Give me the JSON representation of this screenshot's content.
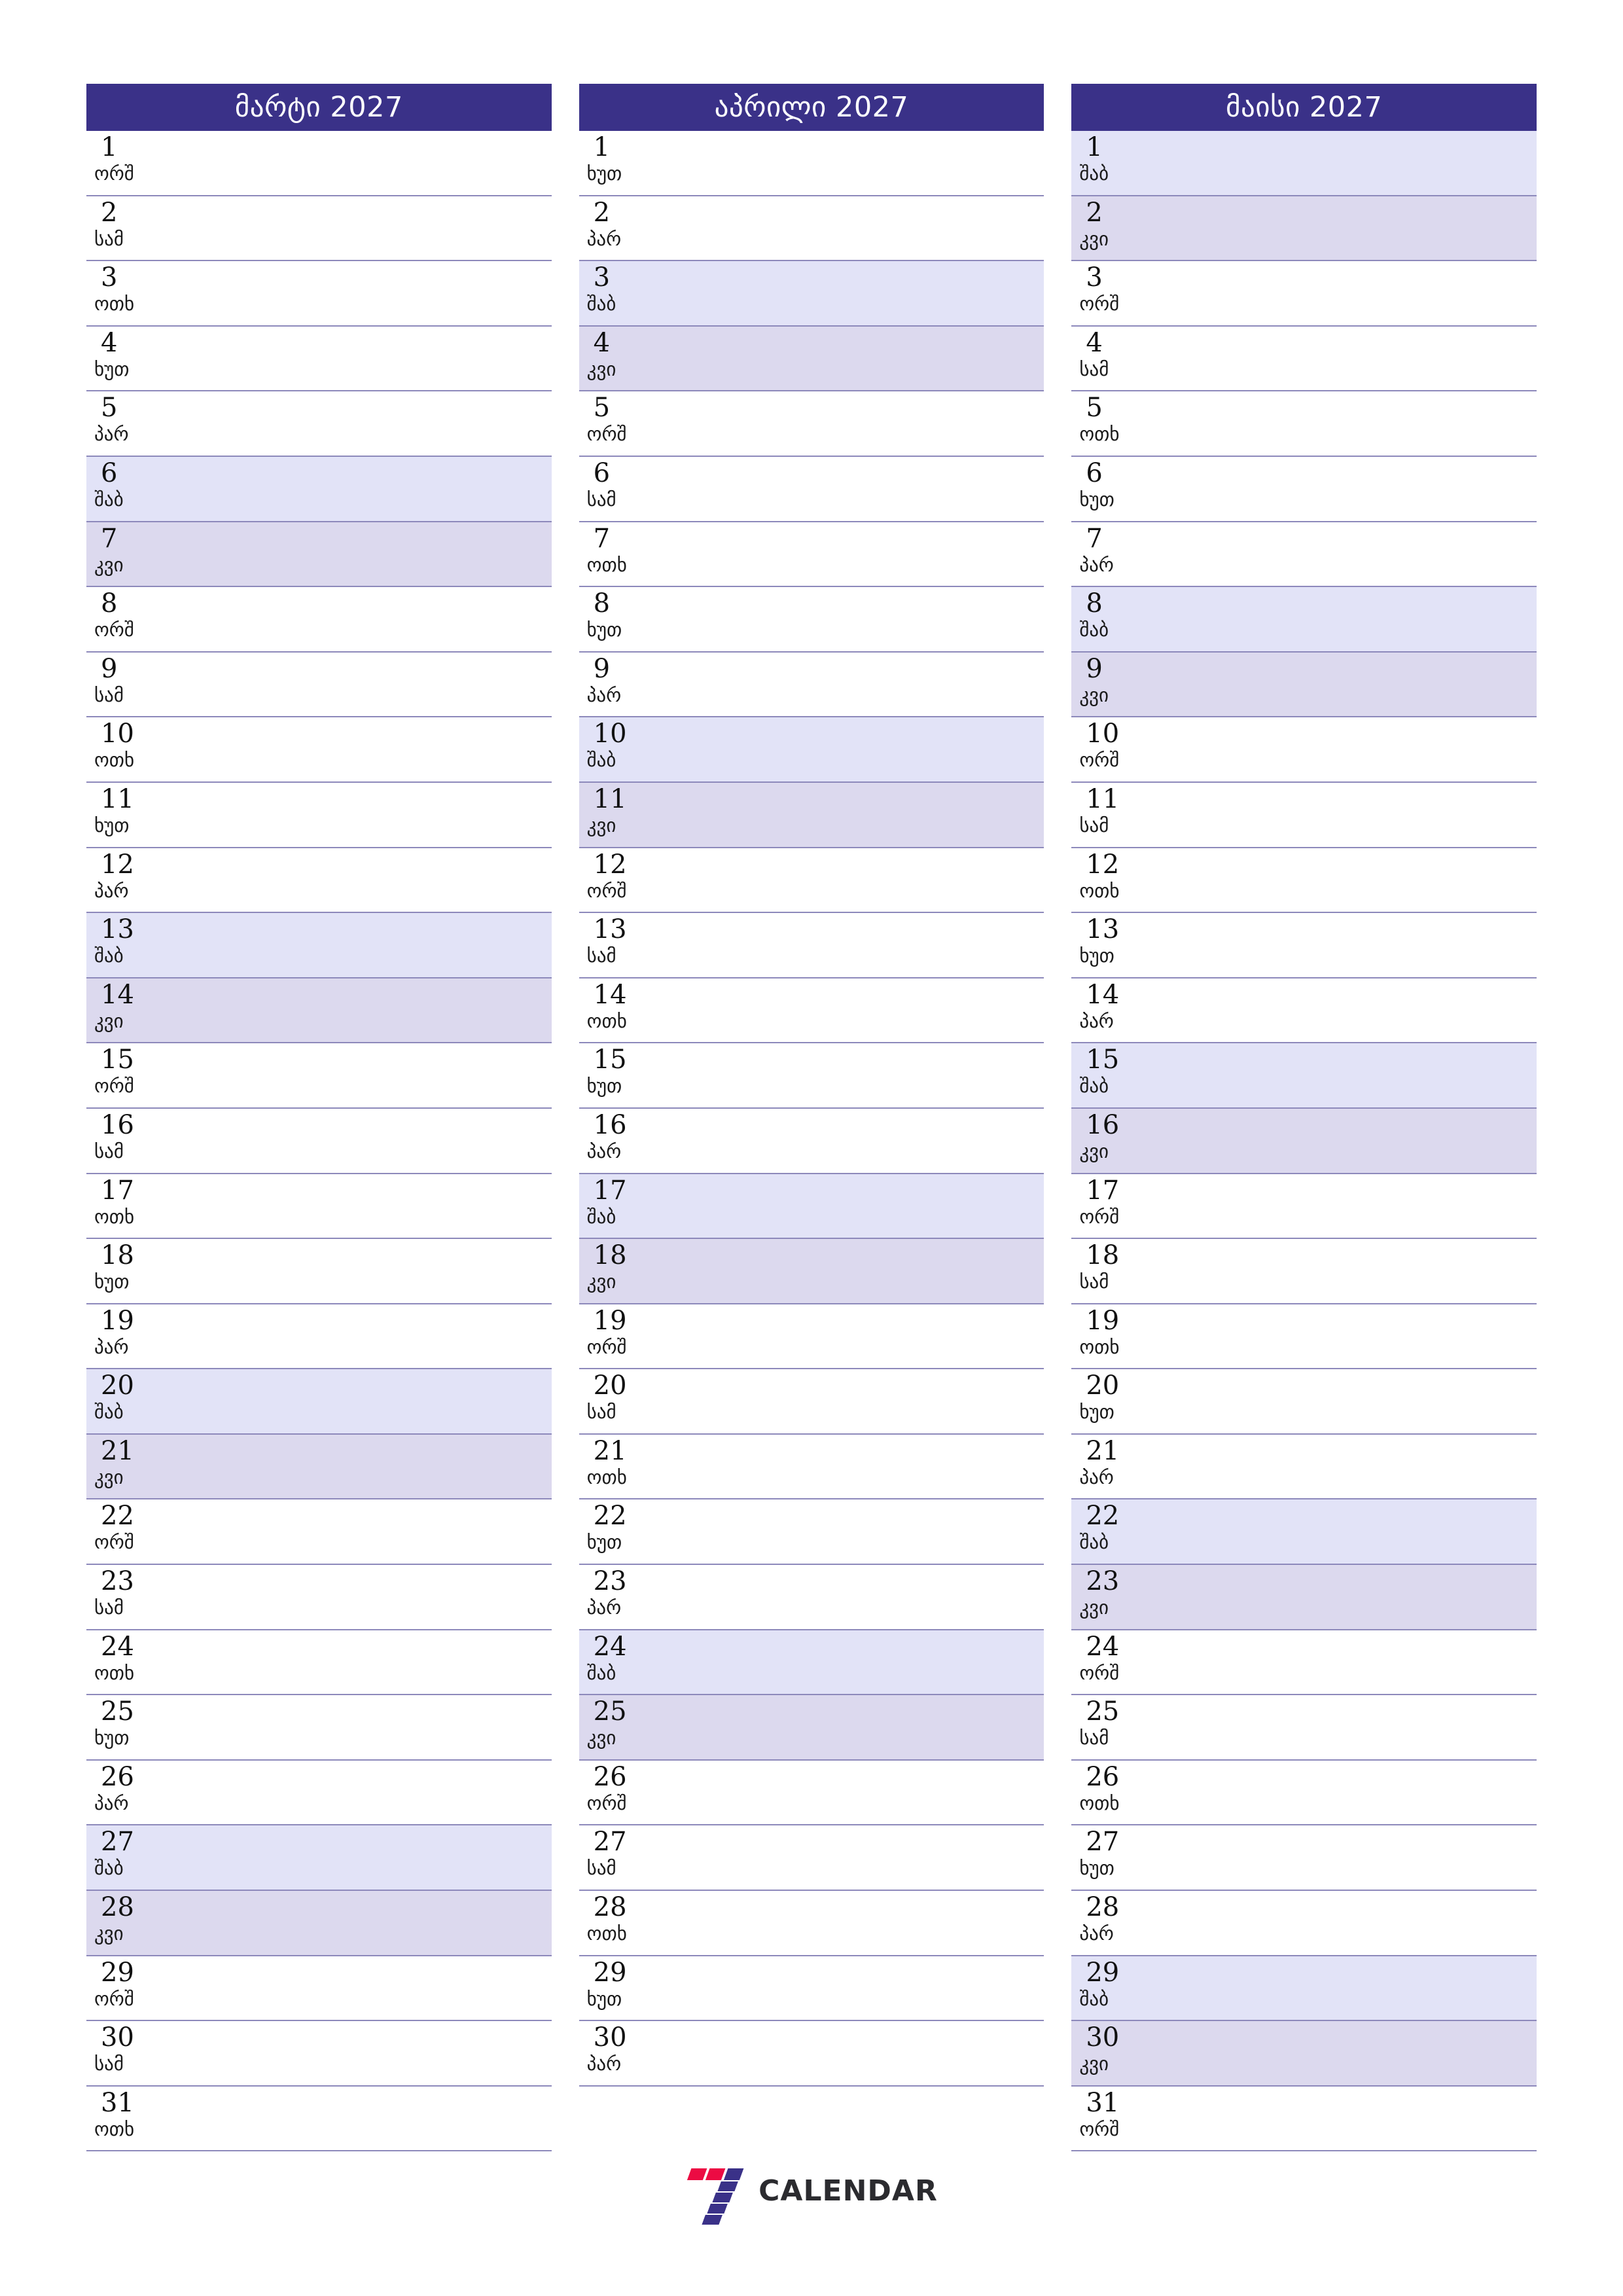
{
  "brand": {
    "name": "CALENDAR",
    "mark_colors": [
      "#ec0b43",
      "#ec0b43",
      "#3a3188",
      "#3a3188",
      "#3a3188",
      "#3a3188",
      "#3a3188"
    ]
  },
  "theme": {
    "header_bg": "#3a3188",
    "header_text": "#ffffff",
    "saturday_bg": "#e2e3f7",
    "sunday_bg": "#dcd9ee",
    "row_line": "#8d89bb",
    "page_bg": "#ffffff",
    "text": "#111111"
  },
  "weekday_abbr": {
    "mon": "ორშ",
    "tue": "სამ",
    "wed": "ოთხ",
    "thu": "ხუთ",
    "fri": "პარ",
    "sat": "შაბ",
    "sun": "კვი"
  },
  "months": [
    {
      "title": "მარტი 2027",
      "days": [
        {
          "n": "1",
          "d": "ორშ",
          "t": "wd"
        },
        {
          "n": "2",
          "d": "სამ",
          "t": "wd"
        },
        {
          "n": "3",
          "d": "ოთხ",
          "t": "wd"
        },
        {
          "n": "4",
          "d": "ხუთ",
          "t": "wd"
        },
        {
          "n": "5",
          "d": "პარ",
          "t": "wd"
        },
        {
          "n": "6",
          "d": "შაბ",
          "t": "sat"
        },
        {
          "n": "7",
          "d": "კვი",
          "t": "sun"
        },
        {
          "n": "8",
          "d": "ორშ",
          "t": "wd"
        },
        {
          "n": "9",
          "d": "სამ",
          "t": "wd"
        },
        {
          "n": "10",
          "d": "ოთხ",
          "t": "wd"
        },
        {
          "n": "11",
          "d": "ხუთ",
          "t": "wd"
        },
        {
          "n": "12",
          "d": "პარ",
          "t": "wd"
        },
        {
          "n": "13",
          "d": "შაბ",
          "t": "sat"
        },
        {
          "n": "14",
          "d": "კვი",
          "t": "sun"
        },
        {
          "n": "15",
          "d": "ორშ",
          "t": "wd"
        },
        {
          "n": "16",
          "d": "სამ",
          "t": "wd"
        },
        {
          "n": "17",
          "d": "ოთხ",
          "t": "wd"
        },
        {
          "n": "18",
          "d": "ხუთ",
          "t": "wd"
        },
        {
          "n": "19",
          "d": "პარ",
          "t": "wd"
        },
        {
          "n": "20",
          "d": "შაბ",
          "t": "sat"
        },
        {
          "n": "21",
          "d": "კვი",
          "t": "sun"
        },
        {
          "n": "22",
          "d": "ორშ",
          "t": "wd"
        },
        {
          "n": "23",
          "d": "სამ",
          "t": "wd"
        },
        {
          "n": "24",
          "d": "ოთხ",
          "t": "wd"
        },
        {
          "n": "25",
          "d": "ხუთ",
          "t": "wd"
        },
        {
          "n": "26",
          "d": "პარ",
          "t": "wd"
        },
        {
          "n": "27",
          "d": "შაბ",
          "t": "sat"
        },
        {
          "n": "28",
          "d": "კვი",
          "t": "sun"
        },
        {
          "n": "29",
          "d": "ორშ",
          "t": "wd"
        },
        {
          "n": "30",
          "d": "სამ",
          "t": "wd"
        },
        {
          "n": "31",
          "d": "ოთხ",
          "t": "wd"
        }
      ]
    },
    {
      "title": "აპრილი 2027",
      "days": [
        {
          "n": "1",
          "d": "ხუთ",
          "t": "wd"
        },
        {
          "n": "2",
          "d": "პარ",
          "t": "wd"
        },
        {
          "n": "3",
          "d": "შაბ",
          "t": "sat"
        },
        {
          "n": "4",
          "d": "კვი",
          "t": "sun"
        },
        {
          "n": "5",
          "d": "ორშ",
          "t": "wd"
        },
        {
          "n": "6",
          "d": "სამ",
          "t": "wd"
        },
        {
          "n": "7",
          "d": "ოთხ",
          "t": "wd"
        },
        {
          "n": "8",
          "d": "ხუთ",
          "t": "wd"
        },
        {
          "n": "9",
          "d": "პარ",
          "t": "wd"
        },
        {
          "n": "10",
          "d": "შაბ",
          "t": "sat"
        },
        {
          "n": "11",
          "d": "კვი",
          "t": "sun"
        },
        {
          "n": "12",
          "d": "ორშ",
          "t": "wd"
        },
        {
          "n": "13",
          "d": "სამ",
          "t": "wd"
        },
        {
          "n": "14",
          "d": "ოთხ",
          "t": "wd"
        },
        {
          "n": "15",
          "d": "ხუთ",
          "t": "wd"
        },
        {
          "n": "16",
          "d": "პარ",
          "t": "wd"
        },
        {
          "n": "17",
          "d": "შაბ",
          "t": "sat"
        },
        {
          "n": "18",
          "d": "კვი",
          "t": "sun"
        },
        {
          "n": "19",
          "d": "ორშ",
          "t": "wd"
        },
        {
          "n": "20",
          "d": "სამ",
          "t": "wd"
        },
        {
          "n": "21",
          "d": "ოთხ",
          "t": "wd"
        },
        {
          "n": "22",
          "d": "ხუთ",
          "t": "wd"
        },
        {
          "n": "23",
          "d": "პარ",
          "t": "wd"
        },
        {
          "n": "24",
          "d": "შაბ",
          "t": "sat"
        },
        {
          "n": "25",
          "d": "კვი",
          "t": "sun"
        },
        {
          "n": "26",
          "d": "ორშ",
          "t": "wd"
        },
        {
          "n": "27",
          "d": "სამ",
          "t": "wd"
        },
        {
          "n": "28",
          "d": "ოთხ",
          "t": "wd"
        },
        {
          "n": "29",
          "d": "ხუთ",
          "t": "wd"
        },
        {
          "n": "30",
          "d": "პარ",
          "t": "wd"
        }
      ]
    },
    {
      "title": "მაისი 2027",
      "days": [
        {
          "n": "1",
          "d": "შაბ",
          "t": "sat"
        },
        {
          "n": "2",
          "d": "კვი",
          "t": "sun"
        },
        {
          "n": "3",
          "d": "ორშ",
          "t": "wd"
        },
        {
          "n": "4",
          "d": "სამ",
          "t": "wd"
        },
        {
          "n": "5",
          "d": "ოთხ",
          "t": "wd"
        },
        {
          "n": "6",
          "d": "ხუთ",
          "t": "wd"
        },
        {
          "n": "7",
          "d": "პარ",
          "t": "wd"
        },
        {
          "n": "8",
          "d": "შაბ",
          "t": "sat"
        },
        {
          "n": "9",
          "d": "კვი",
          "t": "sun"
        },
        {
          "n": "10",
          "d": "ორშ",
          "t": "wd"
        },
        {
          "n": "11",
          "d": "სამ",
          "t": "wd"
        },
        {
          "n": "12",
          "d": "ოთხ",
          "t": "wd"
        },
        {
          "n": "13",
          "d": "ხუთ",
          "t": "wd"
        },
        {
          "n": "14",
          "d": "პარ",
          "t": "wd"
        },
        {
          "n": "15",
          "d": "შაბ",
          "t": "sat"
        },
        {
          "n": "16",
          "d": "კვი",
          "t": "sun"
        },
        {
          "n": "17",
          "d": "ორშ",
          "t": "wd"
        },
        {
          "n": "18",
          "d": "სამ",
          "t": "wd"
        },
        {
          "n": "19",
          "d": "ოთხ",
          "t": "wd"
        },
        {
          "n": "20",
          "d": "ხუთ",
          "t": "wd"
        },
        {
          "n": "21",
          "d": "პარ",
          "t": "wd"
        },
        {
          "n": "22",
          "d": "შაბ",
          "t": "sat"
        },
        {
          "n": "23",
          "d": "კვი",
          "t": "sun"
        },
        {
          "n": "24",
          "d": "ორშ",
          "t": "wd"
        },
        {
          "n": "25",
          "d": "სამ",
          "t": "wd"
        },
        {
          "n": "26",
          "d": "ოთხ",
          "t": "wd"
        },
        {
          "n": "27",
          "d": "ხუთ",
          "t": "wd"
        },
        {
          "n": "28",
          "d": "პარ",
          "t": "wd"
        },
        {
          "n": "29",
          "d": "შაბ",
          "t": "sat"
        },
        {
          "n": "30",
          "d": "კვი",
          "t": "sun"
        },
        {
          "n": "31",
          "d": "ორშ",
          "t": "wd"
        }
      ]
    }
  ]
}
